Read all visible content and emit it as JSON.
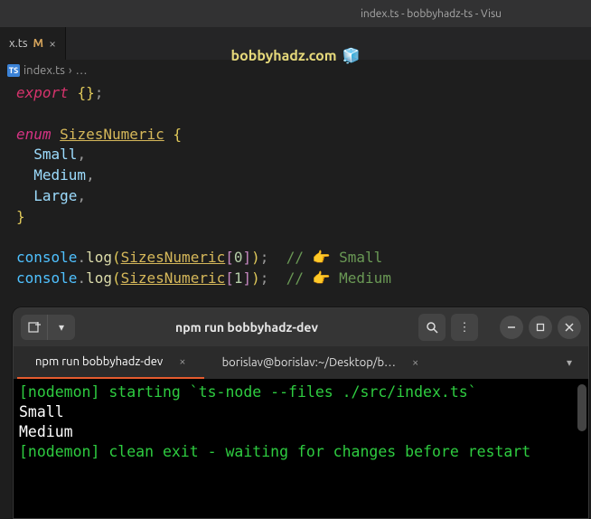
{
  "window": {
    "title": "index.ts - bobbyhadz-ts - Visu"
  },
  "tabs": [
    {
      "label": "x.ts",
      "modified": "M"
    }
  ],
  "watermark": {
    "text": "bobbyhadz.com"
  },
  "breadcrumb": {
    "file": "index.ts",
    "separator": "›",
    "more": "…"
  },
  "code": {
    "l1": {
      "export": "export",
      "braces": "{}",
      "semi": ";"
    },
    "l2": {
      "enum": "enum",
      "name": "SizesNumeric",
      "open": "{"
    },
    "l3": {
      "member": "Small",
      "comma": ","
    },
    "l4": {
      "member": "Medium",
      "comma": ","
    },
    "l5": {
      "member": "Large",
      "comma": ","
    },
    "l6": {
      "close": "}"
    },
    "l7": {
      "obj": "console",
      "dot": ".",
      "method": "log",
      "open": "(",
      "name": "SizesNumeric",
      "bopen": "[",
      "idx": "0",
      "bclose": "]",
      "close": ")",
      "semi": ";",
      "comment_prefix": "// ",
      "emoji": "👉",
      "comment_text": " Small"
    },
    "l8": {
      "obj": "console",
      "dot": ".",
      "method": "log",
      "open": "(",
      "name": "SizesNumeric",
      "bopen": "[",
      "idx": "1",
      "bclose": "]",
      "close": ")",
      "semi": ";",
      "comment_prefix": "// ",
      "emoji": "👉",
      "comment_text": " Medium"
    }
  },
  "terminal": {
    "title": "npm run bobbyhadz-dev",
    "tabs": [
      {
        "label": "npm run bobbyhadz-dev",
        "active": true
      },
      {
        "label": "borislav@borislav:~/Desktop/b…",
        "active": false
      }
    ],
    "output": {
      "l1": "[nodemon] starting `ts-node --files ./src/index.ts`",
      "l2": "Small",
      "l3": "Medium",
      "l4": "[nodemon] clean exit - waiting for changes before restart"
    }
  }
}
